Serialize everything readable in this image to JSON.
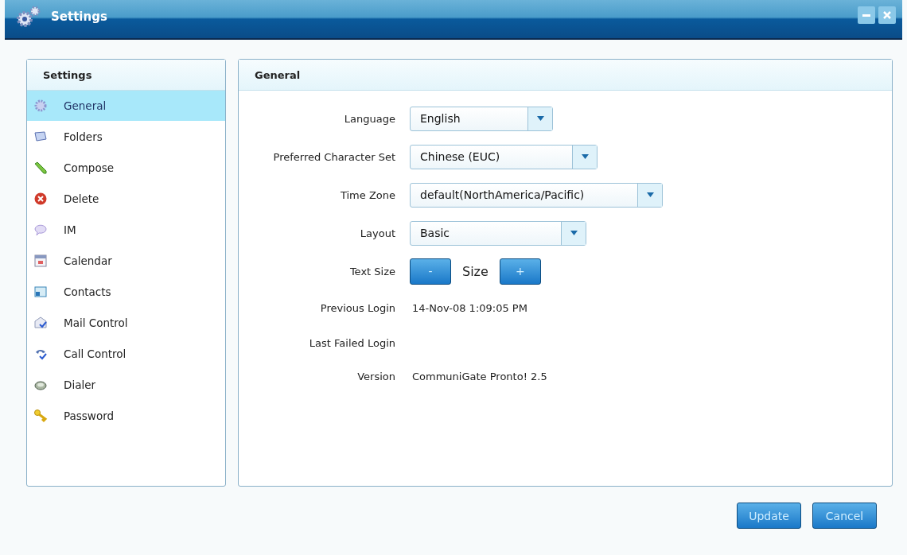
{
  "window": {
    "title": "Settings"
  },
  "sidebar": {
    "title": "Settings",
    "items": [
      {
        "label": "General",
        "selected": true
      },
      {
        "label": "Folders",
        "selected": false
      },
      {
        "label": "Compose",
        "selected": false
      },
      {
        "label": "Delete",
        "selected": false
      },
      {
        "label": "IM",
        "selected": false
      },
      {
        "label": "Calendar",
        "selected": false
      },
      {
        "label": "Contacts",
        "selected": false
      },
      {
        "label": "Mail Control",
        "selected": false
      },
      {
        "label": "Call Control",
        "selected": false
      },
      {
        "label": "Dialer",
        "selected": false
      },
      {
        "label": "Password",
        "selected": false
      }
    ]
  },
  "panel": {
    "title": "General",
    "rows": [
      {
        "kind": "select",
        "label": "Language",
        "value": "English"
      },
      {
        "kind": "select",
        "label": "Preferred Character Set",
        "value": "Chinese (EUC)"
      },
      {
        "kind": "select",
        "label": "Time Zone",
        "value": "default(NorthAmerica/Pacific)"
      },
      {
        "kind": "select",
        "label": "Layout",
        "value": "Basic"
      },
      {
        "kind": "stepper",
        "label": "Text Size",
        "decrease": "-",
        "value": "Size",
        "increase": "+"
      },
      {
        "kind": "text",
        "label": "Previous Login",
        "value": "14-Nov-08 1:09:05 PM"
      },
      {
        "kind": "text",
        "label": "Last Failed Login"
      },
      {
        "kind": "text",
        "label": "Version",
        "value": "CommuniGate Pronto! 2.5"
      }
    ]
  },
  "buttons": [
    "Update",
    "Cancel"
  ]
}
